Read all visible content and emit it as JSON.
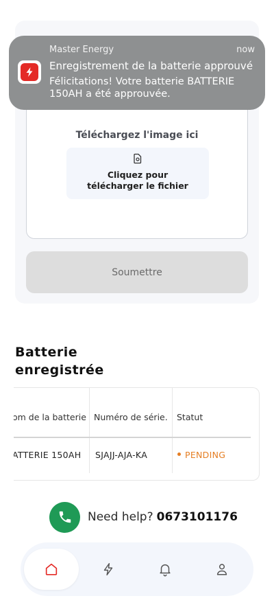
{
  "notification": {
    "app_name": "Master Energy",
    "time": "now",
    "title": "Enregistrement de la batterie approuvé",
    "body": "Félicitations! Votre batterie BATTERIE 150AH a été approuvée."
  },
  "upload": {
    "label": "Téléchargez l'image ici",
    "button_line1": "Cliquez pour",
    "button_line2": "télécharger le fichier"
  },
  "submit_label": "Soumettre",
  "registered": {
    "title_line1": "Batterie",
    "title_line2": "enregistrée",
    "columns": [
      "om de la batterie",
      "Numéro de série.",
      "Statut"
    ],
    "rows": [
      {
        "name": "ATTERIE 150AH",
        "serial": "SJAJJ-AJA-KA",
        "status": "PENDING"
      }
    ]
  },
  "help": {
    "label": "Need help?",
    "phone": "0673101176"
  },
  "nav": {
    "items": [
      "home-icon",
      "lightning-icon",
      "bell-icon",
      "user-icon"
    ],
    "active": "home-icon"
  },
  "colors": {
    "accent_red": "#e42a26",
    "pending": "#e57e23",
    "phone_green": "#1f9a56"
  }
}
